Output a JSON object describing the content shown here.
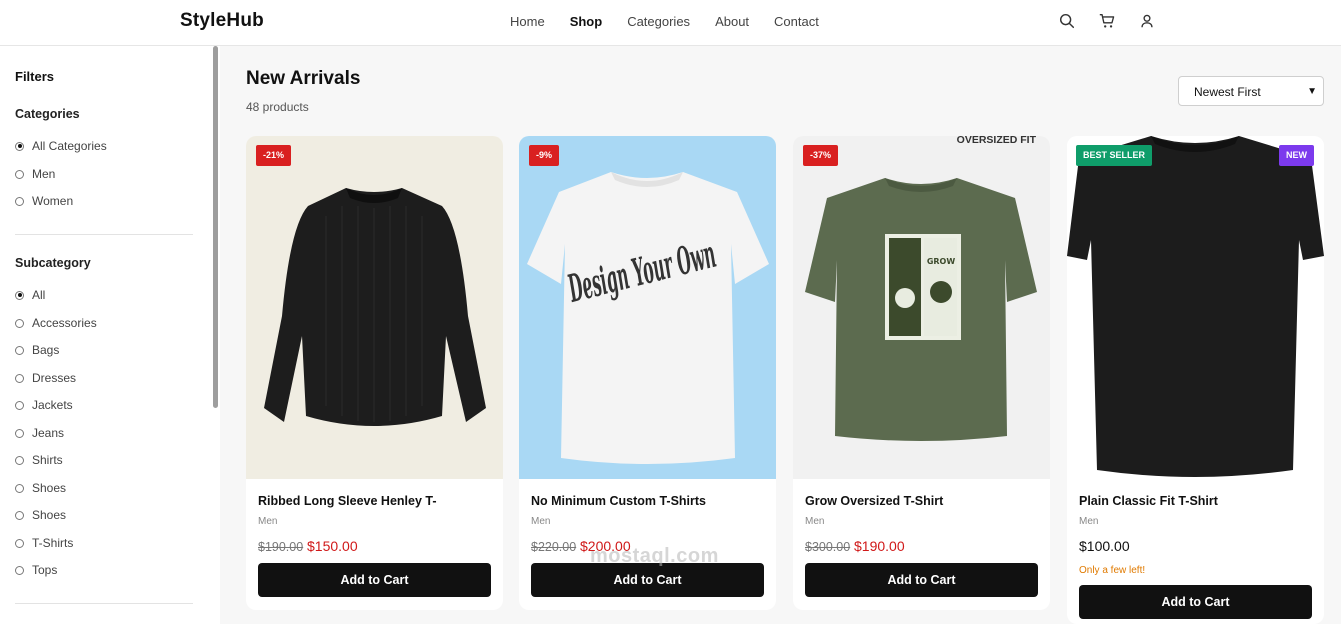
{
  "header": {
    "logo": "StyleHub",
    "nav": [
      "Home",
      "Shop",
      "Categories",
      "About",
      "Contact"
    ],
    "active_nav": "Shop",
    "icons": [
      "search-icon",
      "cart-icon",
      "user-icon"
    ]
  },
  "sidebar": {
    "title": "Filters",
    "categories_heading": "Categories",
    "categories": [
      {
        "label": "All Categories",
        "selected": true
      },
      {
        "label": "Men",
        "selected": false
      },
      {
        "label": "Women",
        "selected": false
      }
    ],
    "subcategory_heading": "Subcategory",
    "subcategories": [
      {
        "label": "All",
        "selected": true
      },
      {
        "label": "Accessories",
        "selected": false
      },
      {
        "label": "Bags",
        "selected": false
      },
      {
        "label": "Dresses",
        "selected": false
      },
      {
        "label": "Jackets",
        "selected": false
      },
      {
        "label": "Jeans",
        "selected": false
      },
      {
        "label": "Shirts",
        "selected": false
      },
      {
        "label": "Shoes",
        "selected": false
      },
      {
        "label": "Shoes",
        "selected": false
      },
      {
        "label": "T-Shirts",
        "selected": false
      },
      {
        "label": "Tops",
        "selected": false
      }
    ]
  },
  "main": {
    "title": "New Arrivals",
    "count": "48 products",
    "sort": "Newest First"
  },
  "products": [
    {
      "name": "Ribbed Long Sleeve Henley T-",
      "category": "Men",
      "old_price": "$190.00",
      "price": "$150.00",
      "badge": "-21%",
      "button": "Add to Cart"
    },
    {
      "name": "No Minimum Custom T-Shirts",
      "category": "Men",
      "old_price": "$220.00",
      "price": "$200.00",
      "badge": "-9%",
      "button": "Add to Cart"
    },
    {
      "name": "Grow Oversized T-Shirt",
      "category": "Men",
      "old_price": "$300.00",
      "price": "$190.00",
      "badge": "-37%",
      "overlay": "OVERSIZED FIT",
      "button": "Add to Cart"
    },
    {
      "name": "Plain Classic Fit T-Shirt",
      "category": "Men",
      "price": "$100.00",
      "badge": "BEST SELLER",
      "badge2": "NEW",
      "note": "Only a few left!",
      "button": "Add to Cart"
    }
  ],
  "product_art": {
    "design_text": "Design Your Own",
    "grow_text": "GROW"
  },
  "watermark": "mostaql.com",
  "colors": {
    "discount_badge": "#d92020",
    "best_seller": "#0f9d6a",
    "new_badge": "#7c3aed",
    "sale_price": "#d01919",
    "button": "#111111",
    "stock_note": "#e07a00"
  }
}
